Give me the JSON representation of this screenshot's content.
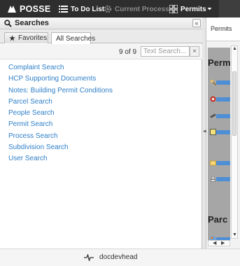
{
  "topbar": {
    "logo_text": "POSSE",
    "nav": {
      "todo_label": "To Do List",
      "current_process_label": "Current Process",
      "permits_label": "Permits"
    }
  },
  "searches_panel": {
    "title": "Searches",
    "collapse_label": "«",
    "tabs": {
      "favorites": "Favorites",
      "all_searches": "All Searches"
    },
    "count": "9 of 9",
    "search": {
      "placeholder": "Text Search...",
      "value": ""
    },
    "clear_label": "×",
    "results": [
      "Complaint Search",
      "HCP Supporting Documents",
      "Notes: Building Permit Conditions",
      "Parcel Search",
      "People Search",
      "Permit Search",
      "Process Search",
      "Subdivision Search",
      "User Search"
    ]
  },
  "permits_panel": {
    "title": "Permits",
    "sections": [
      "Perm",
      "Parc"
    ]
  },
  "statusbar": {
    "user": "docdevhead"
  },
  "colors": {
    "topbar_bg": "#2e2e2e",
    "link": "#2f7fc8",
    "disabled_nav": "#8b8b8b"
  },
  "icons": [
    "posse-logo-icon",
    "list-icon",
    "gear-icon",
    "grid-icon",
    "chevron-down-icon",
    "search-icon",
    "star-icon",
    "pulse-icon"
  ]
}
